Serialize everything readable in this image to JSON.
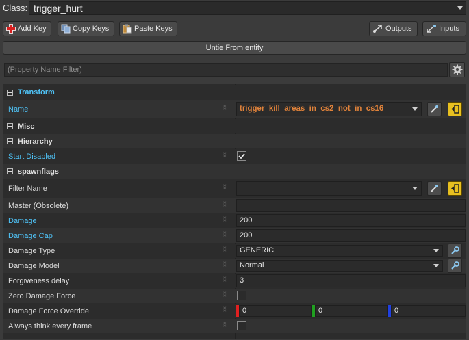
{
  "class_row": {
    "label": "Class:",
    "value": "trigger_hurt"
  },
  "toolbar": {
    "add_key": "Add Key",
    "copy_keys": "Copy Keys",
    "paste_keys": "Paste Keys",
    "outputs": "Outputs",
    "inputs": "Inputs"
  },
  "untie_button": "Untie From entity",
  "filter": {
    "placeholder": "(Property Name Filter)"
  },
  "colors": {
    "modified_label": "#4fc3f7",
    "name_value": "#e0823a",
    "vector_x": "#e02020",
    "vector_y": "#20a020",
    "vector_z": "#2040e0"
  },
  "properties": {
    "transform": {
      "label": "Transform"
    },
    "name": {
      "label": "Name",
      "value": "trigger_kill_areas_in_cs2_not_in_cs16"
    },
    "misc": {
      "label": "Misc"
    },
    "hierarchy": {
      "label": "Hierarchy"
    },
    "start_disabled": {
      "label": "Start Disabled",
      "checked": true
    },
    "spawnflags": {
      "label": "spawnflags"
    },
    "filter_name": {
      "label": "Filter Name",
      "value": ""
    },
    "master": {
      "label": "Master (Obsolete)",
      "value": ""
    },
    "damage": {
      "label": "Damage",
      "value": "200"
    },
    "damage_cap": {
      "label": "Damage Cap",
      "value": "200"
    },
    "damage_type": {
      "label": "Damage Type",
      "value": "GENERIC"
    },
    "damage_model": {
      "label": "Damage Model",
      "value": "Normal"
    },
    "forgiveness_delay": {
      "label": "Forgiveness delay",
      "value": "3"
    },
    "zero_damage_force": {
      "label": "Zero Damage Force",
      "checked": false
    },
    "damage_force_override": {
      "label": "Damage Force Override",
      "x": "0",
      "y": "0",
      "z": "0"
    },
    "always_think": {
      "label": "Always think every frame",
      "checked": false
    }
  }
}
